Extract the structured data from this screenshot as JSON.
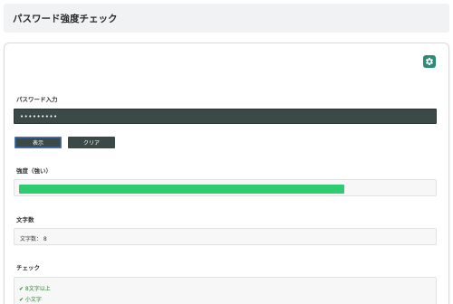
{
  "header": {
    "title": "パスワード強度チェック"
  },
  "settings": {
    "icon": "gear-icon"
  },
  "password": {
    "label": "パスワード入力",
    "value": "•••••••••"
  },
  "buttons": {
    "show": "表示",
    "clear": "クリア"
  },
  "strength": {
    "label": "強度（強い）",
    "level": 0.79,
    "color": "#2ecc71"
  },
  "count": {
    "label": "文字数",
    "text": "文字数： 8"
  },
  "checks": {
    "label": "チェック",
    "items": [
      "✔ 8文字以上",
      "✔ 小文字"
    ]
  }
}
